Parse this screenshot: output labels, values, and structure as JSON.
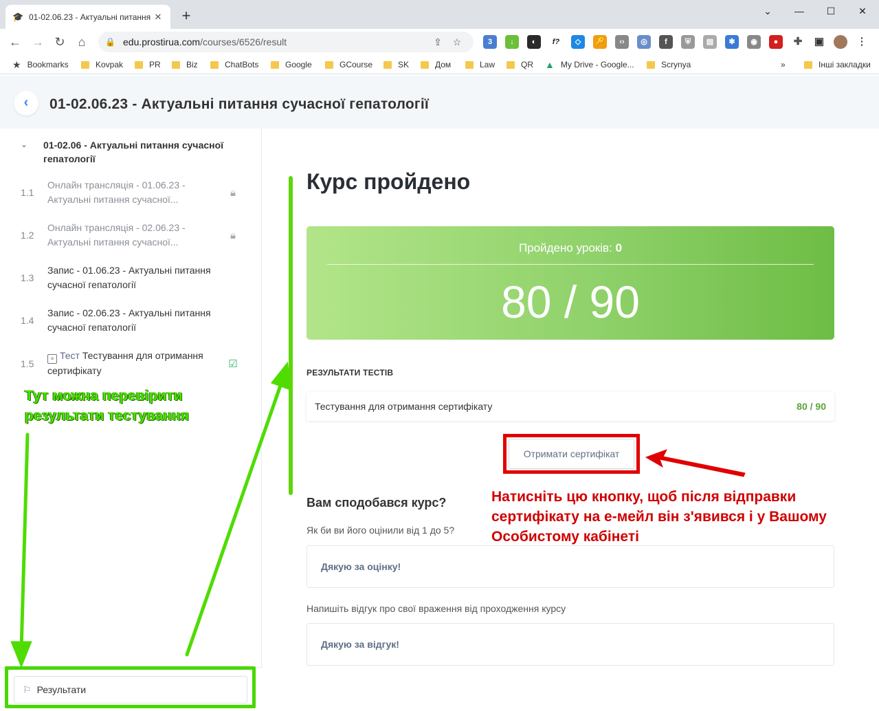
{
  "browser": {
    "tab_title": "01-02.06.23 - Актуальні питання",
    "url_host": "edu.prostirua.com",
    "url_path": "/courses/6526/result",
    "bookmarks": [
      "Bookmarks",
      "Kovpak",
      "PR",
      "Biz",
      "ChatBots",
      "Google",
      "GCourse",
      "SK",
      "Дом",
      "Law",
      "QR",
      "My Drive - Google...",
      "Scrynya"
    ],
    "other_bookmarks": "Інші закладки"
  },
  "header": {
    "title": "01-02.06.23 - Актуальні питання сучасної гепатології"
  },
  "sidebar": {
    "section_title": "01-02.06 - Актуальні питання сучасної гепатології",
    "lessons": [
      {
        "num": "1.1",
        "text": "Онлайн трансляція - 01.06.23 - Актуальні питання сучасної...",
        "status": "locked"
      },
      {
        "num": "1.2",
        "text": "Онлайн трансляція - 02.06.23 - Актуальні питання сучасної...",
        "status": "locked"
      },
      {
        "num": "1.3",
        "text": "Запис - 01.06.23 - Актуальні питання сучасної гепатології",
        "status": ""
      },
      {
        "num": "1.4",
        "text": "Запис - 02.06.23 - Актуальні питання сучасної гепатології",
        "status": ""
      },
      {
        "num": "1.5",
        "type_label": "Тест",
        "text": "Тестування для отримання сертифікату",
        "status": "done"
      }
    ],
    "results_button": "Результати"
  },
  "main": {
    "heading": "Курс пройдено",
    "lessons_passed_label": "Пройдено уроків:",
    "lessons_passed_value": "0",
    "score": "80 / 90",
    "test_results_label": "РЕЗУЛЬТАТИ ТЕСТІВ",
    "test_name": "Тестування для отримання сертифікату",
    "test_score": "80 / 90",
    "certificate_button": "Отримати сертифікат",
    "feedback_title": "Вам сподобався курс?",
    "rating_question": "Як би ви його оцінили від 1 до 5?",
    "rating_thanks": "Дякую за оцінку!",
    "review_question": "Напишіть відгук про свої враження від проходження курсу",
    "review_thanks": "Дякую за відгук!"
  },
  "annotations": {
    "green_line1": "Тут можна перевірити",
    "green_line2": "результати тестування",
    "red_line1": "Натисніть цю кнопку, щоб після відправки",
    "red_line2": "сертифікату на е-мейл він з'явився і у Вашому",
    "red_line3": "Особистому кабінеті"
  },
  "colors": {
    "annotation_green": "#48e400",
    "annotation_red": "#e10000",
    "card_gradient_start": "#b2e589",
    "card_gradient_end": "#6ebd45"
  }
}
